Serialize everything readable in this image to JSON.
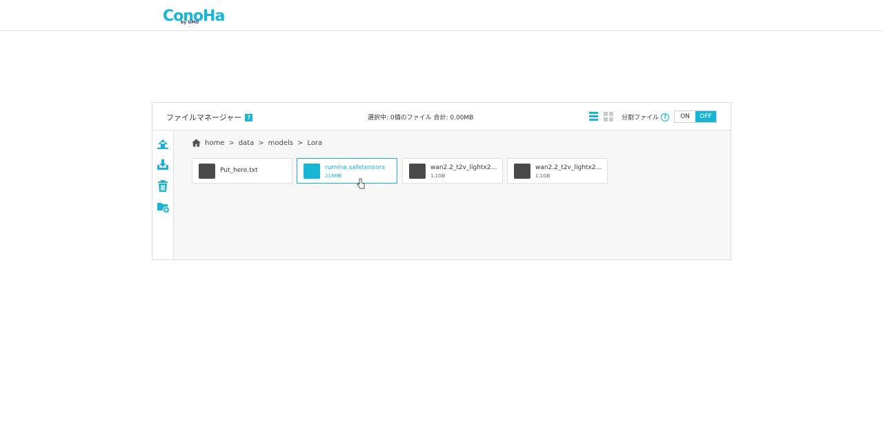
{
  "app": {
    "logo_text": "ConoHa",
    "logo_sub": "by GMO"
  },
  "file_manager": {
    "title": "ファイルマネージャー",
    "help_mark": "?",
    "status": "選択中: 0個のファイル 合計: 0.00MB",
    "split_label": "分割ファイル",
    "split_help": "?",
    "toggle_on": "ON",
    "toggle_off": "OFF",
    "toggle_state": "OFF"
  },
  "sidebar": {
    "actions": [
      "upload-icon",
      "download-icon",
      "trash-icon",
      "new-folder-icon"
    ]
  },
  "breadcrumb": {
    "items": [
      "home",
      "data",
      "models",
      "Lora"
    ],
    "separator": ">"
  },
  "files": [
    {
      "name": "Put_here.txt",
      "size": ""
    },
    {
      "name": "rumina.safetensors",
      "size": "218MB",
      "selected": true
    },
    {
      "name": "wan2.2_t2v_lightx2v_…",
      "size": "1.1GB"
    },
    {
      "name": "wan2.2_t2v_lightx2v_…",
      "size": "1.1GB"
    }
  ],
  "colors": {
    "accent": "#19b5d6",
    "icon_dark": "#4a4a4a",
    "panel_bg": "#f7f7f7"
  }
}
